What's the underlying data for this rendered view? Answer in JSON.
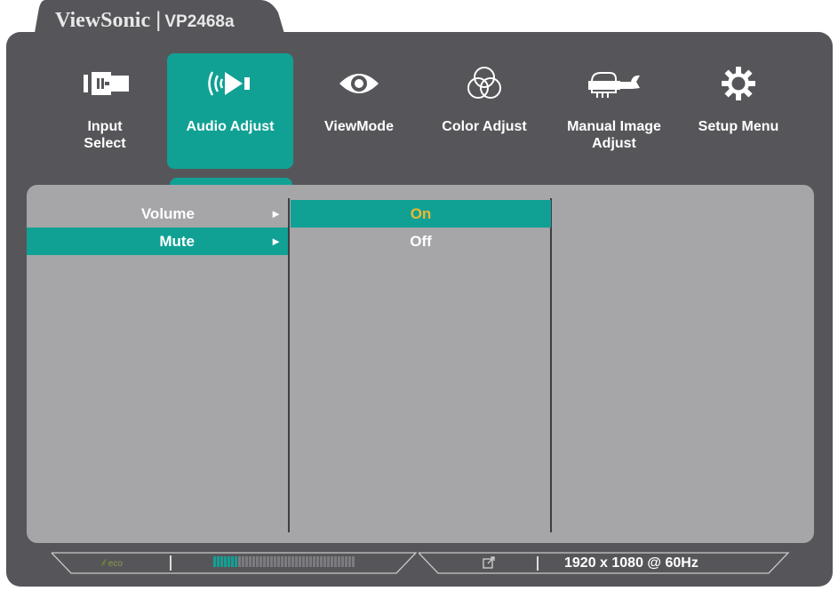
{
  "header": {
    "brand": "ViewSonic",
    "separator": "|",
    "model": "VP2468a"
  },
  "menu": {
    "items": [
      {
        "label": "Input\nSelect",
        "icon": "input-select-icon"
      },
      {
        "label": "Audio Adjust",
        "icon": "audio-adjust-icon",
        "selected": true
      },
      {
        "label": "ViewMode",
        "icon": "eye-icon"
      },
      {
        "label": "Color Adjust",
        "icon": "color-circles-icon"
      },
      {
        "label": "Manual Image\nAdjust",
        "icon": "hand-wrench-icon"
      },
      {
        "label": "Setup Menu",
        "icon": "gear-icon"
      }
    ]
  },
  "submenu": {
    "items": [
      {
        "label": "Volume",
        "arrow": "►"
      },
      {
        "label": "Mute",
        "arrow": "►",
        "selected": true
      }
    ]
  },
  "options": {
    "items": [
      {
        "label": "On",
        "selected": true,
        "color": "#f0b72f"
      },
      {
        "label": "Off"
      }
    ]
  },
  "status": {
    "eco_label": "eco",
    "resolution": "1920 x 1080 @ 60Hz",
    "level_filled": 7,
    "level_total": 40
  },
  "colors": {
    "accent": "#10a194",
    "panel": "#a6a6a9",
    "frame": "#56565a",
    "highlight_text": "#f0b72f"
  }
}
